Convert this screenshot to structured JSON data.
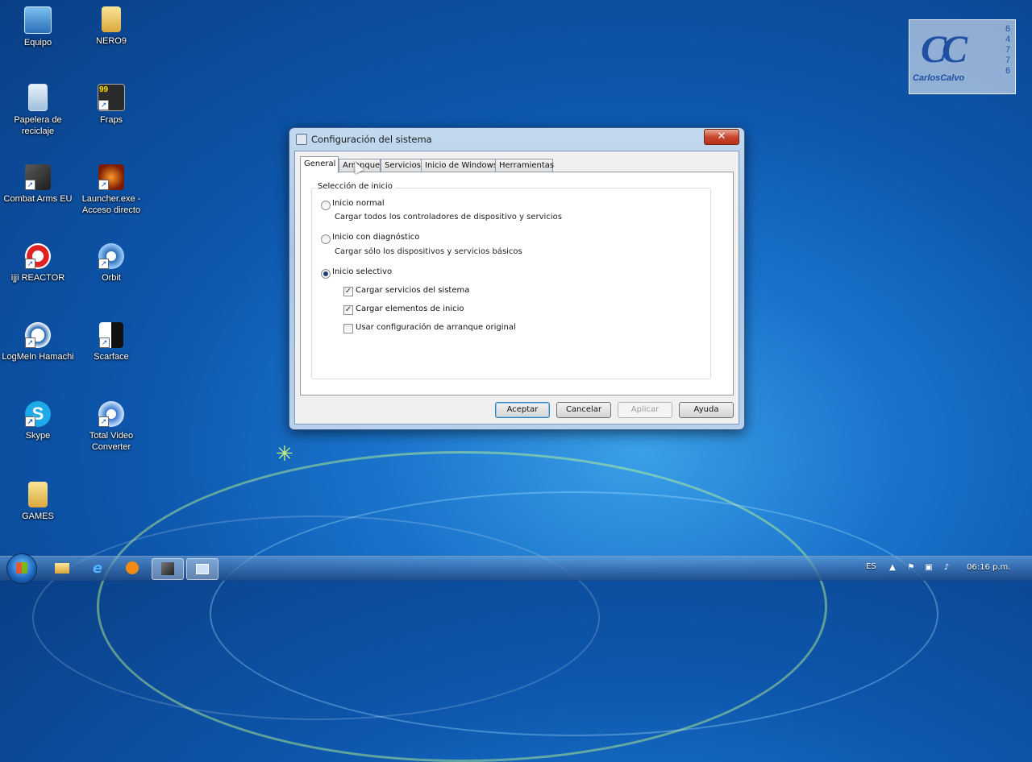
{
  "desktop": {
    "icons": [
      {
        "label": "Equipo",
        "icon": "computer-icon"
      },
      {
        "label": "NERO9",
        "icon": "folder-icon"
      },
      {
        "label": "Papelera de reciclaje",
        "icon": "recycle-bin-icon"
      },
      {
        "label": "Fraps",
        "icon": "fraps-icon",
        "badge": "99"
      },
      {
        "label": "Combat Arms EU",
        "icon": "game-icon"
      },
      {
        "label": "Launcher.exe - Acceso directo",
        "icon": "launcher-icon"
      },
      {
        "label": "ijji REACTOR",
        "icon": "reactor-icon"
      },
      {
        "label": "Orbit",
        "icon": "orbit-icon"
      },
      {
        "label": "LogMeIn Hamachi",
        "icon": "hamachi-icon"
      },
      {
        "label": "Scarface",
        "icon": "scarface-icon"
      },
      {
        "label": "Skype",
        "icon": "skype-icon"
      },
      {
        "label": "Total Video Converter",
        "icon": "video-converter-icon"
      },
      {
        "label": "GAMES",
        "icon": "folder-icon"
      }
    ],
    "logo": {
      "name": "CarlosCalvo",
      "number": "64776",
      "mark": "CC"
    }
  },
  "dialog": {
    "title": "Configuración del sistema",
    "close": "✕",
    "tabs": [
      "General",
      "Arranque",
      "Servicios",
      "Inicio de Windows",
      "Herramientas"
    ],
    "active_tab": "General",
    "group_label": "Selección de inicio",
    "options": {
      "normal": {
        "label": "Inicio normal",
        "desc": "Cargar todos los controladores de dispositivo y servicios",
        "selected": false
      },
      "diag": {
        "label": "Inicio con diagnóstico",
        "desc": "Cargar sólo los dispositivos y servicios básicos",
        "selected": false
      },
      "selective": {
        "label": "Inicio selectivo",
        "selected": true
      }
    },
    "checks": {
      "services": {
        "label": "Cargar servicios del sistema",
        "checked": true
      },
      "startup": {
        "label": "Cargar elementos de inicio",
        "checked": true
      },
      "boot": {
        "label": "Usar configuración de arranque original",
        "checked": false
      }
    },
    "check_mark": "✓",
    "buttons": {
      "ok": "Aceptar",
      "cancel": "Cancelar",
      "apply": "Aplicar",
      "help": "Ayuda"
    }
  },
  "taskbar": {
    "items": [
      "explorer-icon",
      "ie-icon",
      "media-player-icon",
      "combat-arms-icon",
      "msconfig-icon"
    ],
    "language": "ES",
    "time": "06:16 p.m."
  },
  "colors": {
    "accent": "#1a74cc",
    "close": "#c8452f"
  }
}
